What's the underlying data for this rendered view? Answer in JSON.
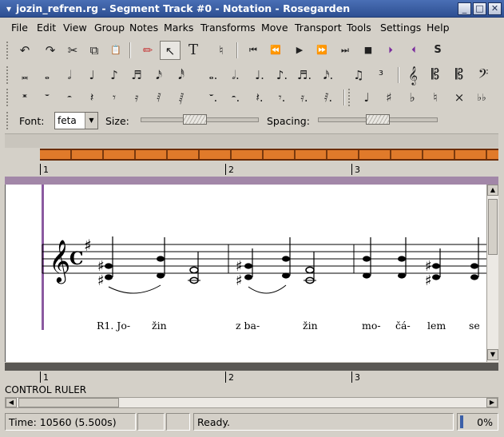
{
  "window": {
    "title": "jozin_refren.rg - Segment Track #0 - Notation - Rosegarden",
    "min_glyph": "_",
    "max_glyph": "□",
    "close_glyph": "✕"
  },
  "menu": [
    {
      "id": "file",
      "label": "File"
    },
    {
      "id": "edit",
      "label": "Edit"
    },
    {
      "id": "view",
      "label": "View"
    },
    {
      "id": "group",
      "label": "Group"
    },
    {
      "id": "notes",
      "label": "Notes"
    },
    {
      "id": "marks",
      "label": "Marks"
    },
    {
      "id": "transforms",
      "label": "Transforms"
    },
    {
      "id": "move",
      "label": "Move"
    },
    {
      "id": "transport",
      "label": "Transport"
    },
    {
      "id": "tools",
      "label": "Tools"
    },
    {
      "id": "settings",
      "label": "Settings"
    },
    {
      "id": "help",
      "label": "Help"
    }
  ],
  "toolbar1": {
    "undo": "↶",
    "redo": "↷",
    "cut": "✂",
    "copy": "⧉",
    "paste": "📋",
    "erase": "✏",
    "select": "↖",
    "text": "T",
    "insert_marker": "♮",
    "rewind_start": "⏮",
    "rewind": "⏪",
    "play": "▶",
    "ffwd": "⏩",
    "ffwd_end": "⏭",
    "stop": "■",
    "loop_start": "⏵",
    "loop_end": "⏴",
    "solo": "S"
  },
  "toolbar2": {
    "notes": [
      "𝅜",
      "𝅝",
      "𝅗𝅥",
      "♩",
      "♪",
      "♬",
      "𝅘𝅥𝅯",
      "𝅘𝅥𝅰",
      "𝅝.",
      "𝅗𝅥.",
      "♩.",
      "♪.",
      "♬.",
      "𝅘𝅥𝅯."
    ],
    "chord": "♫",
    "triplet": "³",
    "clefs": [
      "𝄞",
      "𝄡",
      "𝄡",
      "𝄢"
    ]
  },
  "toolbar3": {
    "rests": [
      "𝄺",
      "𝄻",
      "𝄼",
      "𝄽",
      "𝄾",
      "𝄿",
      "𝅀",
      "𝅁",
      "𝄻.",
      "𝄼.",
      "𝄽.",
      "𝄾.",
      "𝄿.",
      "𝅀."
    ],
    "accidentals": [
      "♩",
      "♯",
      "♭",
      "♮",
      "×",
      "♭♭"
    ]
  },
  "fontbar": {
    "font_label": "Font:",
    "font_value": "feta",
    "size_label": "Size:",
    "size_level": 0.45,
    "spacing_label": "Spacing:",
    "spacing_level": 0.5
  },
  "ruler": {
    "bars": [
      "1",
      "2",
      "3"
    ]
  },
  "score": {
    "lyrics": [
      "R1. Jo-",
      "žin",
      "z ba-",
      "žin",
      "mo-",
      "čá-",
      "lem",
      "se"
    ]
  },
  "control_ruler_label": "CONTROL RULER",
  "status": {
    "time": "Time: 10560 (5.500s)",
    "message": "Ready.",
    "progress": "0%"
  }
}
